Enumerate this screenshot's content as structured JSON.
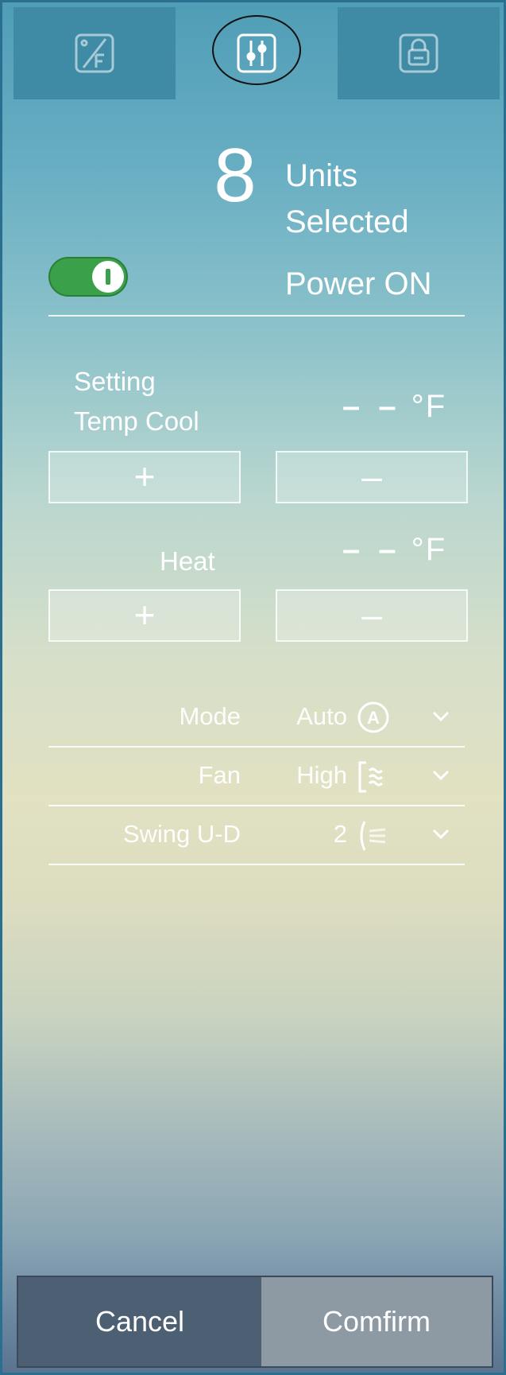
{
  "tabs": [
    {
      "icon": "temperature-f-icon",
      "active": false
    },
    {
      "icon": "sliders-icon",
      "active": true
    },
    {
      "icon": "lock-icon",
      "active": false
    }
  ],
  "header": {
    "count": "8",
    "units_line1": "Units",
    "units_line2": "Selected",
    "power_label": "Power ON",
    "power_on": true
  },
  "cool": {
    "label_line1": "Setting",
    "label_line2": "Temp Cool",
    "value": "– –",
    "unit": "°F",
    "plus": "+",
    "minus": "–"
  },
  "heat": {
    "label": "Heat",
    "value": "– –",
    "unit": "°F",
    "plus": "+",
    "minus": "–"
  },
  "settings": [
    {
      "label": "Mode",
      "value": "Auto",
      "icon": "auto-mode-icon"
    },
    {
      "label": "Fan",
      "value": "High",
      "icon": "fan-speed-icon"
    },
    {
      "label": "Swing U-D",
      "value": "2",
      "icon": "swing-icon"
    }
  ],
  "footer": {
    "cancel": "Cancel",
    "confirm": "Comfirm"
  },
  "colors": {
    "toggle_on": "#3aa04a",
    "tab_inactive": "#3f8aa4",
    "footer_cancel": "#4d5f72",
    "footer_confirm": "#8d99a3"
  }
}
